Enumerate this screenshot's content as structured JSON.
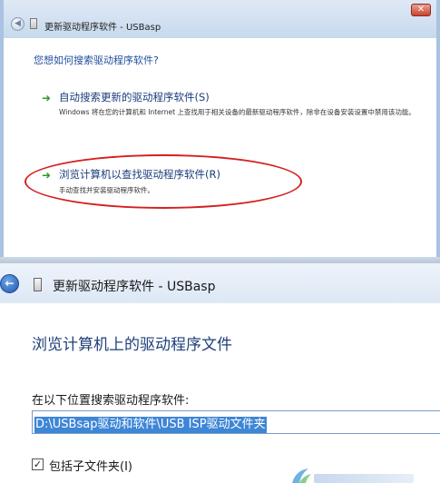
{
  "top_window": {
    "title": "更新驱动程序软件 - USBasp",
    "close_glyph": "✕",
    "back_glyph": "◀",
    "heading": "您想如何搜索驱动程序软件?",
    "option_auto": {
      "arrow": "➜",
      "title": "自动搜索更新的驱动程序软件(S)",
      "description": "Windows 将在您的计算机和 Internet 上查找用于相关设备的最新驱动程序软件，除非在设备安装设置中禁用该功能。"
    },
    "option_browse": {
      "arrow": "➜",
      "title": "浏览计算机以查找驱动程序软件(R)",
      "description": "手动查找并安装驱动程序软件。"
    }
  },
  "bottom_window": {
    "title": "更新驱动程序软件 - USBasp",
    "back_glyph": "←",
    "heading": "浏览计算机上的驱动程序文件",
    "search_label": "在以下位置搜索驱动程序软件:",
    "path_value": "D:\\USBsap驱动和软件\\USB ISP驱动文件夹",
    "include_subfolders_label": "包括子文件夹(I)",
    "include_subfolders_checked": true,
    "check_glyph": "✓"
  },
  "colors": {
    "heading_blue": "#1f4e9c",
    "option_arrow_green": "#2e9a2e",
    "highlight_red": "#d42020",
    "selection_blue": "#3e86d6"
  },
  "icons": {
    "top_back": "back-arrow-icon",
    "top_wizard": "wizard-icon",
    "top_close": "close-icon",
    "bottom_back": "back-arrow-icon",
    "bottom_wizard": "wizard-icon",
    "option_arrows": "green-arrow-icon",
    "checkbox": "checkmark-icon",
    "watermark": "watermark-logo-icon"
  }
}
